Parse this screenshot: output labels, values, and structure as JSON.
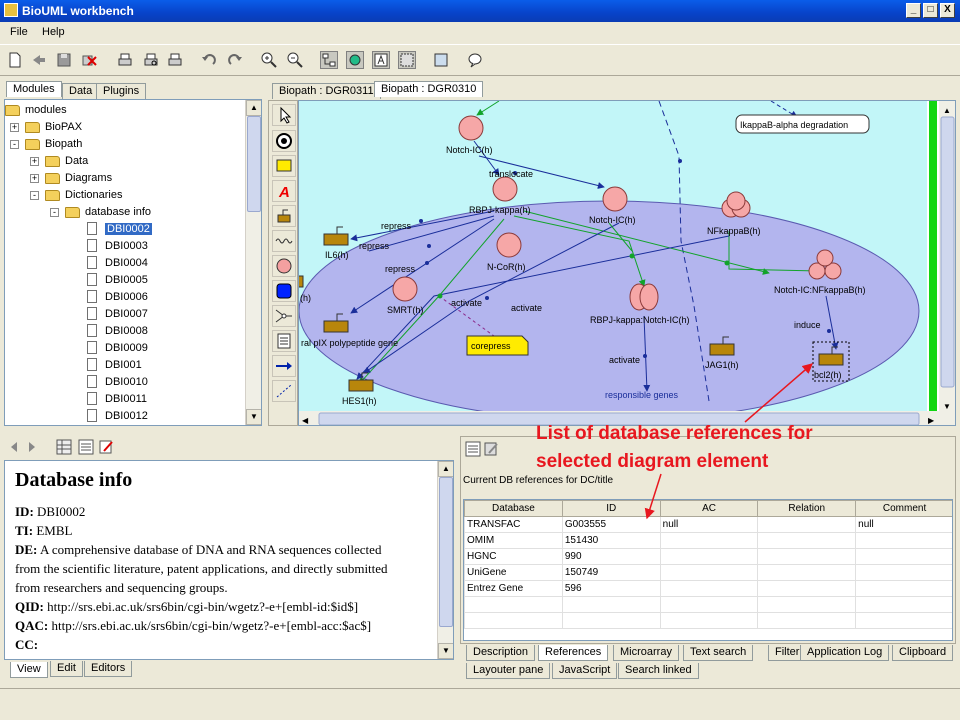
{
  "window": {
    "title": "BioUML workbench",
    "min": "_",
    "max": "□",
    "close": "X"
  },
  "menu": [
    "File",
    "Help"
  ],
  "left_tabs": [
    "Modules",
    "Data",
    "Plugins"
  ],
  "tree": [
    {
      "label": "modules",
      "level": 0,
      "type": "folder-open"
    },
    {
      "label": "BioPAX",
      "level": 1,
      "type": "folder",
      "exp": "+"
    },
    {
      "label": "Biopath",
      "level": 1,
      "type": "folder-open",
      "exp": "-"
    },
    {
      "label": "Data",
      "level": 2,
      "type": "folder",
      "exp": "+"
    },
    {
      "label": "Diagrams",
      "level": 2,
      "type": "folder",
      "exp": "+"
    },
    {
      "label": "Dictionaries",
      "level": 2,
      "type": "folder-open",
      "exp": "-"
    },
    {
      "label": "database info",
      "level": 3,
      "type": "folder-open",
      "exp": "-"
    },
    {
      "label": "DBI0002",
      "level": 4,
      "type": "doc",
      "selected": true
    },
    {
      "label": "DBI0003",
      "level": 4,
      "type": "doc"
    },
    {
      "label": "DBI0004",
      "level": 4,
      "type": "doc"
    },
    {
      "label": "DBI0005",
      "level": 4,
      "type": "doc"
    },
    {
      "label": "DBI0006",
      "level": 4,
      "type": "doc"
    },
    {
      "label": "DBI0007",
      "level": 4,
      "type": "doc"
    },
    {
      "label": "DBI0008",
      "level": 4,
      "type": "doc"
    },
    {
      "label": "DBI0009",
      "level": 4,
      "type": "doc"
    },
    {
      "label": "DBI001",
      "level": 4,
      "type": "doc"
    },
    {
      "label": "DBI0010",
      "level": 4,
      "type": "doc"
    },
    {
      "label": "DBI0011",
      "level": 4,
      "type": "doc"
    },
    {
      "label": "DBI0012",
      "level": 4,
      "type": "doc"
    }
  ],
  "diagram_tabs": [
    "Biopath : DGR0311",
    "Biopath : DGR0310"
  ],
  "diagram": {
    "labels": {
      "notch_top": "Notch-IC(h)",
      "translocate": "translocate",
      "rbpj": "RBPJ-kappa(h)",
      "notch_mid": "Notch-IC(h)",
      "nfkb": "NFkappaB(h)",
      "il6": "IL6(h)",
      "repress1": "repress",
      "repress2": "repress",
      "repress3": "repress",
      "ncor": "N-CoR(h)",
      "notch_nfkb": "Notch-IC:NFkappaB(h)",
      "h": "(h)",
      "smrt": "SMRT(h)",
      "activate1": "activate",
      "activate2": "activate",
      "rbpj_notch": "RBPJ-kappa:Notch-IC(h)",
      "induce": "induce",
      "polypeptide": "ral pIX polypeptide gene",
      "corepress": "corepress",
      "activate3": "activate",
      "jag1": "JAG1(h)",
      "bcl2": "bcl2(h)",
      "hes1": "HES1(h)",
      "responsible": "responsible genes",
      "ikb": "IkappaB-alpha degradation"
    }
  },
  "callout": {
    "line1": "List of database references for",
    "line2": "selected diagram element"
  },
  "info": {
    "title": "Database info",
    "id_label": "ID:",
    "id": "DBI0002",
    "ti_label": "TI:",
    "ti": "EMBL",
    "de_label": "DE:",
    "de1": "A comprehensive database of DNA and RNA sequences collected",
    "de2": "from the scientific literature, patent applications, and directly submitted",
    "de3": "from researchers and sequencing groups.",
    "qid_label": "QID:",
    "qid": "http://srs.ebi.ac.uk/srs6bin/cgi-bin/wgetz?-e+[embl-id:$id$]",
    "qac_label": "QAC:",
    "qac": "http://srs.ebi.ac.uk/srs6bin/cgi-bin/wgetz?-e+[embl-acc:$ac$]",
    "cc_label": "CC:"
  },
  "info_tabs": [
    "View",
    "Edit",
    "Editors"
  ],
  "refs": {
    "caption": "Current DB references for DC/title",
    "columns": [
      "Database",
      "ID",
      "AC",
      "Relation",
      "Comment"
    ],
    "rows": [
      [
        "TRANSFAC",
        "G003555",
        "null",
        "",
        "null"
      ],
      [
        "OMIM",
        "151430",
        "",
        "",
        ""
      ],
      [
        "HGNC",
        "990",
        "",
        "",
        ""
      ],
      [
        "UniGene",
        "150749",
        "",
        "",
        ""
      ],
      [
        "Entrez Gene",
        "596",
        "",
        "",
        ""
      ]
    ]
  },
  "bottom_tabs_row1": [
    "Description",
    "References",
    "Microarray",
    "Text search",
    "Filter",
    "Application Log",
    "Clipboard"
  ],
  "bottom_tabs_row2": [
    "Layouter pane",
    "JavaScript",
    "Search linked"
  ]
}
